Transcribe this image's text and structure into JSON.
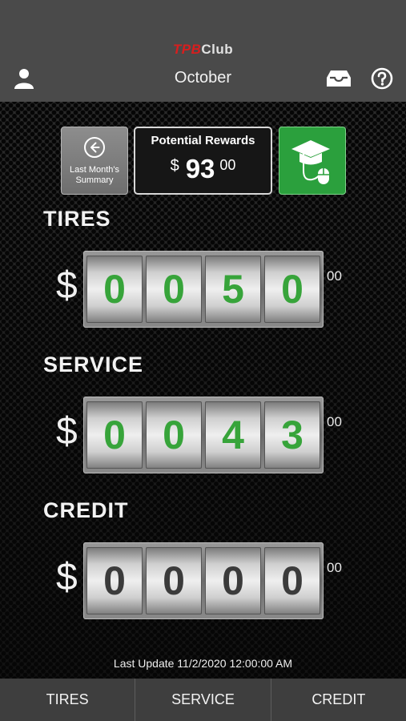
{
  "header": {
    "brand_part1": "TPB",
    "brand_part2": "Club",
    "month": "October",
    "icons": [
      "user-icon",
      "inbox-icon",
      "help-icon"
    ]
  },
  "summary": {
    "last_month_label": "Last Month's Summary",
    "potential_title": "Potential Rewards",
    "potential_currency": "$",
    "potential_whole": "93",
    "potential_cents": "00",
    "education_icon": "graduation-cap-mouse-icon"
  },
  "sections": [
    {
      "title": "TIRES",
      "currency": "$",
      "digits": [
        "0",
        "0",
        "5",
        "0"
      ],
      "cents": "00",
      "digit_color": "#37a43a"
    },
    {
      "title": "SERVICE",
      "currency": "$",
      "digits": [
        "0",
        "0",
        "4",
        "3"
      ],
      "cents": "00",
      "digit_color": "#37a43a"
    },
    {
      "title": "CREDIT",
      "currency": "$",
      "digits": [
        "0",
        "0",
        "0",
        "0"
      ],
      "cents": "00",
      "digit_color": "#3b3b3b"
    }
  ],
  "last_update": "Last Update 11/2/2020 12:00:00 AM",
  "tabs": [
    {
      "label": "TIRES"
    },
    {
      "label": "SERVICE"
    },
    {
      "label": "CREDIT"
    }
  ],
  "colors": {
    "accent_green": "#2ba03d",
    "brand_red": "#d81e1e",
    "header_bg": "#4a4a4a",
    "tabbar_bg": "#3e3e3e"
  }
}
